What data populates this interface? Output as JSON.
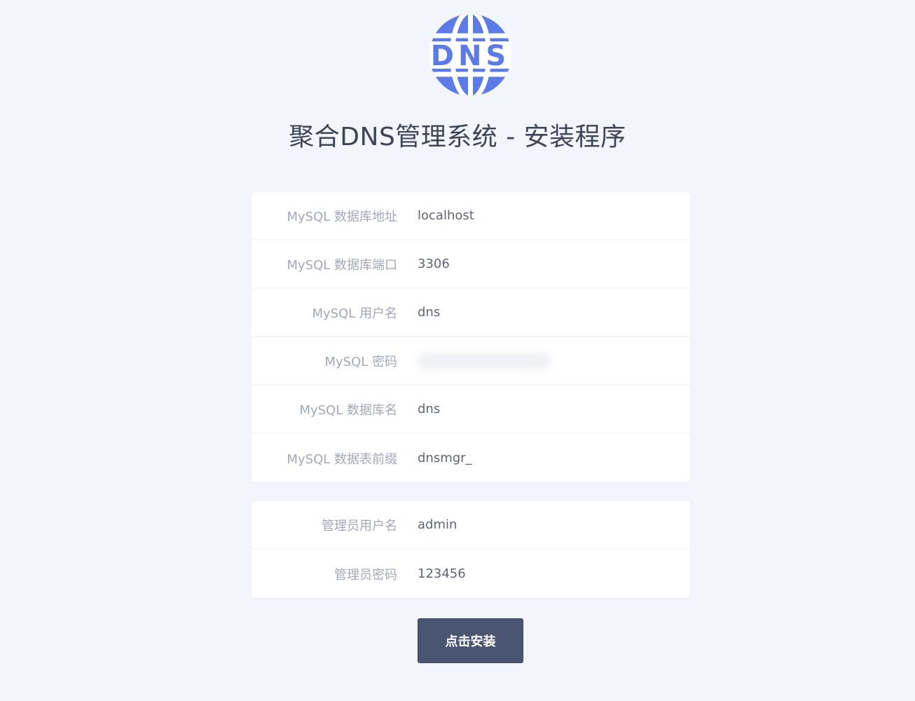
{
  "logo": {
    "text": "DNS",
    "icon": "globe-dns-icon",
    "color": "#5b7bea"
  },
  "title": "聚合DNS管理系统 - 安装程序",
  "db_form": {
    "host": {
      "label": "MySQL 数据库地址",
      "value": "localhost"
    },
    "port": {
      "label": "MySQL 数据库端口",
      "value": "3306"
    },
    "user": {
      "label": "MySQL 用户名",
      "value": "dns"
    },
    "password": {
      "label": "MySQL 密码",
      "value": ""
    },
    "dbname": {
      "label": "MySQL 数据库名",
      "value": "dns"
    },
    "prefix": {
      "label": "MySQL 数据表前缀",
      "value": "dnsmgr_"
    }
  },
  "admin_form": {
    "username": {
      "label": "管理员用户名",
      "value": "admin"
    },
    "password": {
      "label": "管理员密码",
      "value": "123456"
    }
  },
  "install_button": "点击安装",
  "colors": {
    "background": "#f2f6fc",
    "button": "#4a5571",
    "accent": "#5b7bea"
  }
}
